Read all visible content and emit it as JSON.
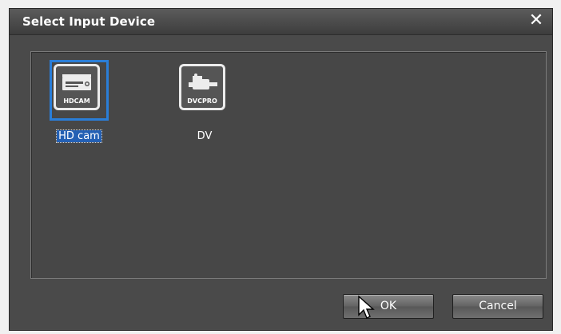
{
  "dialog": {
    "title": "Select Input Device",
    "close_glyph": "✕"
  },
  "devices": [
    {
      "tile_label": "HDCAM",
      "caption": "HD cam",
      "icon": "hdcam-deck-icon",
      "selected": true
    },
    {
      "tile_label": "DVCPRO",
      "caption": "DV",
      "icon": "dvcpro-camera-icon",
      "selected": false
    }
  ],
  "buttons": {
    "ok": "OK",
    "cancel": "Cancel"
  },
  "colors": {
    "dialog_bg": "#4a4a4a",
    "selection_border": "#2a7ed8",
    "selection_text_bg": "#2460b4"
  }
}
